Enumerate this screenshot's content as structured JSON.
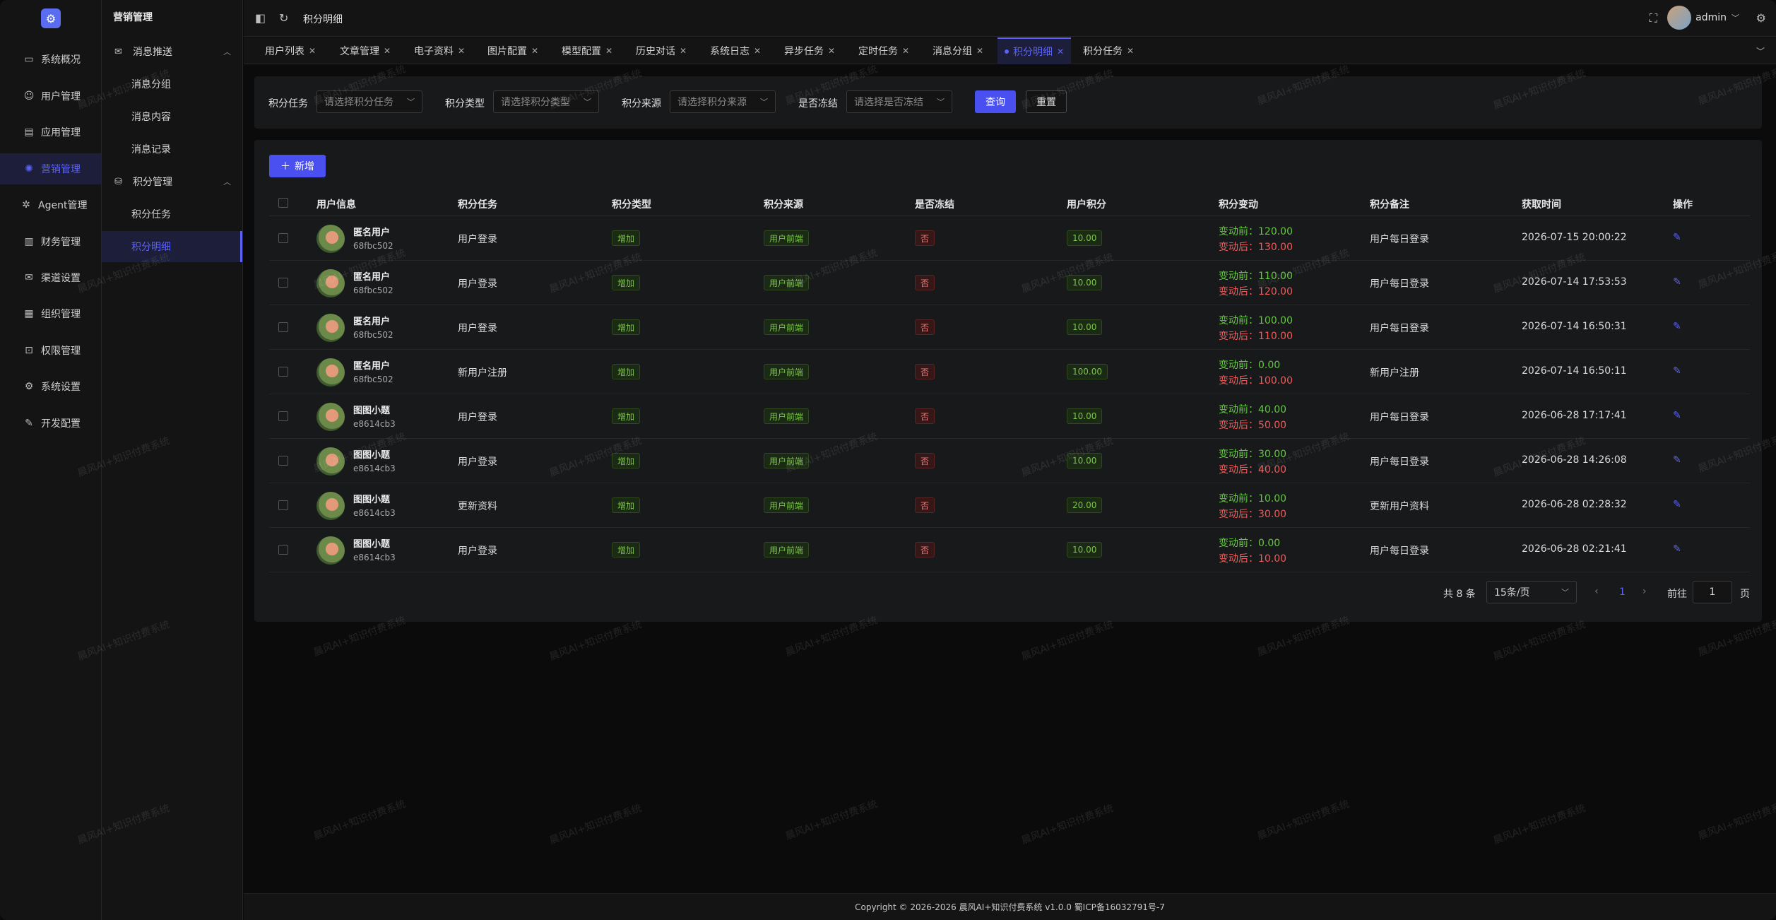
{
  "nav1": {
    "items": [
      {
        "label": "系统概况",
        "icon": "monitor-icon"
      },
      {
        "label": "用户管理",
        "icon": "user-icon"
      },
      {
        "label": "应用管理",
        "icon": "app-icon"
      },
      {
        "label": "营销管理",
        "icon": "marketing-icon"
      },
      {
        "label": "Agent管理",
        "icon": "agent-icon"
      },
      {
        "label": "财务管理",
        "icon": "finance-icon"
      },
      {
        "label": "渠道设置",
        "icon": "mail-icon"
      },
      {
        "label": "组织管理",
        "icon": "org-icon"
      },
      {
        "label": "权限管理",
        "icon": "lock-icon"
      },
      {
        "label": "系统设置",
        "icon": "gear-icon"
      },
      {
        "label": "开发配置",
        "icon": "edit-icon"
      }
    ],
    "active_index": 3
  },
  "nav2": {
    "title": "营销管理",
    "groups": [
      {
        "label": "消息推送",
        "items": [
          "消息分组",
          "消息内容",
          "消息记录"
        ]
      },
      {
        "label": "积分管理",
        "items": [
          "积分任务",
          "积分明细"
        ]
      }
    ],
    "active_item": "积分明细"
  },
  "header": {
    "breadcrumb": "积分明细",
    "username": "admin"
  },
  "tabs": [
    {
      "label": "用户列表"
    },
    {
      "label": "文章管理"
    },
    {
      "label": "电子资料"
    },
    {
      "label": "图片配置"
    },
    {
      "label": "模型配置"
    },
    {
      "label": "历史对话"
    },
    {
      "label": "系统日志"
    },
    {
      "label": "异步任务"
    },
    {
      "label": "定时任务"
    },
    {
      "label": "消息分组"
    },
    {
      "label": "积分明细",
      "active": true
    },
    {
      "label": "积分任务"
    }
  ],
  "filter": {
    "task_label": "积分任务",
    "task_placeholder": "请选择积分任务",
    "type_label": "积分类型",
    "type_placeholder": "请选择积分类型",
    "source_label": "积分来源",
    "source_placeholder": "请选择积分来源",
    "frozen_label": "是否冻结",
    "frozen_placeholder": "请选择是否冻结",
    "query_label": "查询",
    "reset_label": "重置"
  },
  "table": {
    "add_label": "新增",
    "headers": [
      "用户信息",
      "积分任务",
      "积分类型",
      "积分来源",
      "是否冻结",
      "用户积分",
      "积分变动",
      "积分备注",
      "获取时间",
      "操作"
    ],
    "before_prefix": "变动前：",
    "after_prefix": "变动后：",
    "rows": [
      {
        "name": "匿名用户",
        "uid": "68fbc502",
        "task": "用户登录",
        "type": "增加",
        "source": "用户前端",
        "frozen": "否",
        "points": "10.00",
        "before": "120.00",
        "after": "130.00",
        "remark": "用户每日登录",
        "time": "2026-07-15 20:00:22"
      },
      {
        "name": "匿名用户",
        "uid": "68fbc502",
        "task": "用户登录",
        "type": "增加",
        "source": "用户前端",
        "frozen": "否",
        "points": "10.00",
        "before": "110.00",
        "after": "120.00",
        "remark": "用户每日登录",
        "time": "2026-07-14 17:53:53"
      },
      {
        "name": "匿名用户",
        "uid": "68fbc502",
        "task": "用户登录",
        "type": "增加",
        "source": "用户前端",
        "frozen": "否",
        "points": "10.00",
        "before": "100.00",
        "after": "110.00",
        "remark": "用户每日登录",
        "time": "2026-07-14 16:50:31"
      },
      {
        "name": "匿名用户",
        "uid": "68fbc502",
        "task": "新用户注册",
        "type": "增加",
        "source": "用户前端",
        "frozen": "否",
        "points": "100.00",
        "before": "0.00",
        "after": "100.00",
        "remark": "新用户注册",
        "time": "2026-07-14 16:50:11"
      },
      {
        "name": "图图小题",
        "uid": "e8614cb3",
        "task": "用户登录",
        "type": "增加",
        "source": "用户前端",
        "frozen": "否",
        "points": "10.00",
        "before": "40.00",
        "after": "50.00",
        "remark": "用户每日登录",
        "time": "2026-06-28 17:17:41"
      },
      {
        "name": "图图小题",
        "uid": "e8614cb3",
        "task": "用户登录",
        "type": "增加",
        "source": "用户前端",
        "frozen": "否",
        "points": "10.00",
        "before": "30.00",
        "after": "40.00",
        "remark": "用户每日登录",
        "time": "2026-06-28 14:26:08"
      },
      {
        "name": "图图小题",
        "uid": "e8614cb3",
        "task": "更新资料",
        "type": "增加",
        "source": "用户前端",
        "frozen": "否",
        "points": "20.00",
        "before": "10.00",
        "after": "30.00",
        "remark": "更新用户资料",
        "time": "2026-06-28 02:28:32"
      },
      {
        "name": "图图小题",
        "uid": "e8614cb3",
        "task": "用户登录",
        "type": "增加",
        "source": "用户前端",
        "frozen": "否",
        "points": "10.00",
        "before": "0.00",
        "after": "10.00",
        "remark": "用户每日登录",
        "time": "2026-06-28 02:21:41"
      }
    ]
  },
  "pagination": {
    "total_text": "共 8 条",
    "page_size": "15条/页",
    "current_page": "1",
    "goto_label": "前往",
    "goto_value": "1",
    "page_suffix": "页"
  },
  "footer": {
    "text": "Copyright © 2026-2026 晨风AI+知识付费系统 v1.0.0  蜀ICP备16032791号-7"
  },
  "watermark": "晨风AI+知识付费系统",
  "colors": {
    "accent": "#5b62f5",
    "primary_button": "#4a4ff0",
    "increase_green": "#63c83f",
    "decrease_red": "#f05a5a"
  }
}
